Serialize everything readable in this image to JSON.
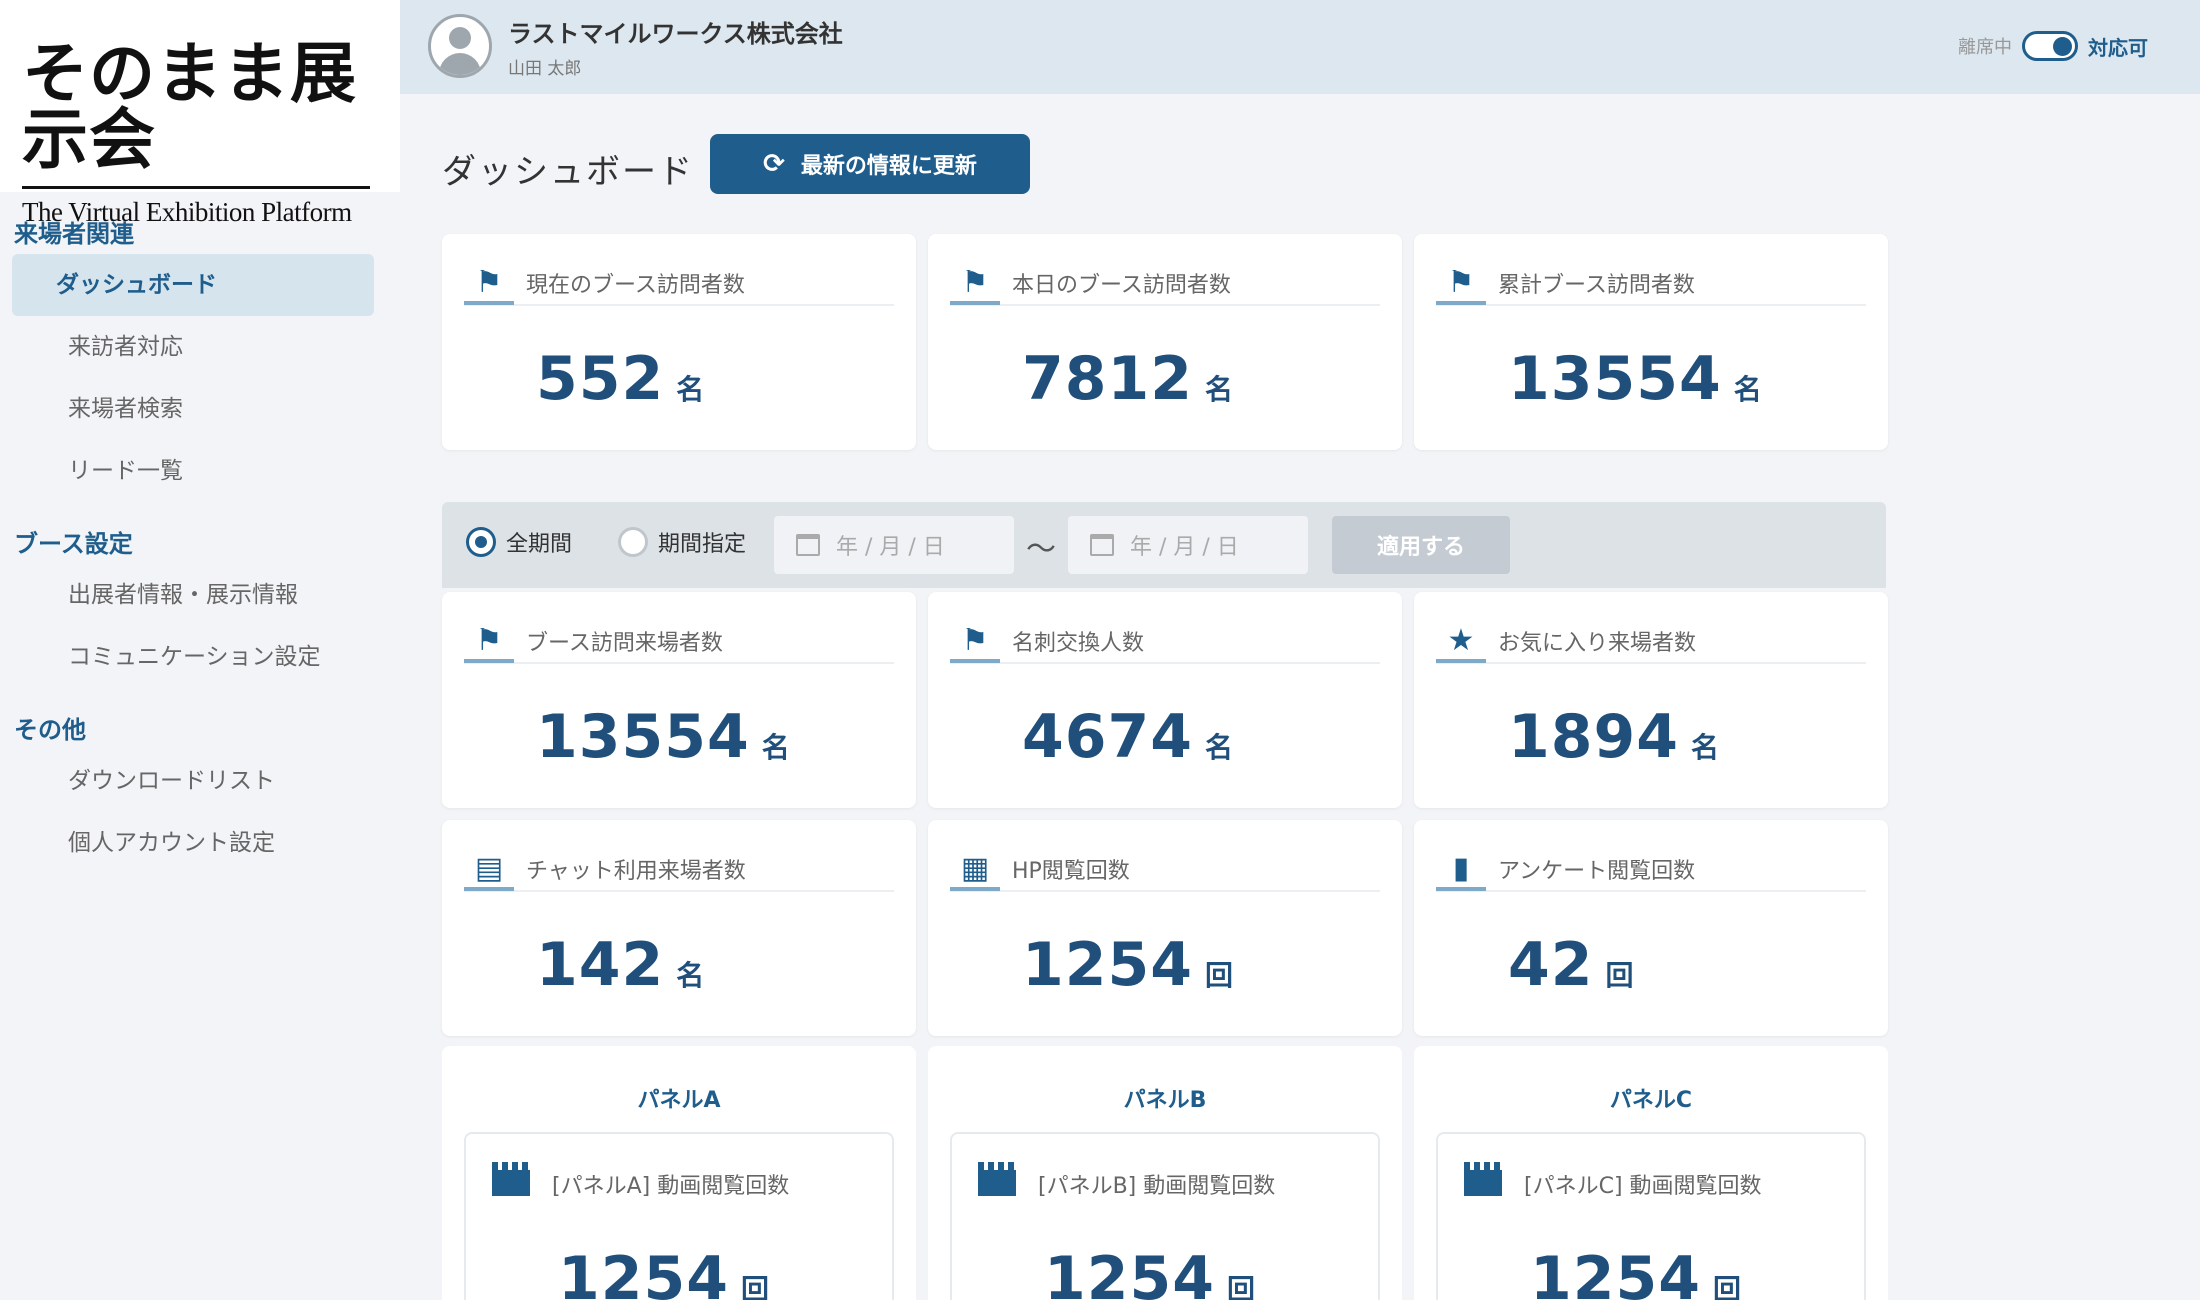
{
  "brand": {
    "title": "そのまま展示会",
    "subtitle": "The Virtual Exhibition Platform"
  },
  "sidebar": {
    "sections": [
      {
        "title": "来場者関連",
        "items": [
          "ダッシュボード",
          "来訪者対応",
          "来場者検索",
          "リード一覧"
        ]
      },
      {
        "title": "ブース設定",
        "items": [
          "出展者情報・展示情報",
          "コミュニケーション設定"
        ]
      },
      {
        "title": "その他",
        "items": [
          "ダウンロードリスト",
          "個人アカウント設定"
        ]
      }
    ]
  },
  "header": {
    "company": "ラストマイルワークス株式会社",
    "user": "山田 太郎",
    "status_off": "離席中",
    "status_on": "対応可"
  },
  "main": {
    "page_title": "ダッシュボード",
    "refresh_label": "最新の情報に更新",
    "top_cards": [
      {
        "label": "現在のブース訪問者数",
        "value": "552",
        "unit": "名",
        "icon": "visitors-icon"
      },
      {
        "label": "本日のブース訪問者数",
        "value": "7812",
        "unit": "名",
        "icon": "visitors-icon"
      },
      {
        "label": "累計ブース訪問者数",
        "value": "13554",
        "unit": "名",
        "icon": "visitors-icon"
      }
    ],
    "filter": {
      "all_period": "全期間",
      "custom_period": "期間指定",
      "date_placeholder": "年 / 月 / 日",
      "tilde": "～",
      "apply": "適用する"
    },
    "stat_cards": [
      {
        "label": "ブース訪問来場者数",
        "value": "13554",
        "unit": "名",
        "icon": "visitors-icon"
      },
      {
        "label": "名刺交換人数",
        "value": "4674",
        "unit": "名",
        "icon": "visitors-icon"
      },
      {
        "label": "お気に入り来場者数",
        "value": "1894",
        "unit": "名",
        "icon": "star-icon"
      },
      {
        "label": "チャット利用来場者数",
        "value": "142",
        "unit": "名",
        "icon": "chat-icon"
      },
      {
        "label": "HP閲覧回数",
        "value": "1254",
        "unit": "回",
        "icon": "browser-icon"
      },
      {
        "label": "アンケート閲覧回数",
        "value": "42",
        "unit": "回",
        "icon": "document-icon"
      }
    ],
    "panels": [
      {
        "title": "パネルA",
        "label": "[パネルA] 動画閲覧回数",
        "value": "1254",
        "unit": "回"
      },
      {
        "title": "パネルB",
        "label": "[パネルB] 動画閲覧回数",
        "value": "1254",
        "unit": "回"
      },
      {
        "title": "パネルC",
        "label": "[パネルC] 動画閲覧回数",
        "value": "1254",
        "unit": "回"
      }
    ]
  }
}
